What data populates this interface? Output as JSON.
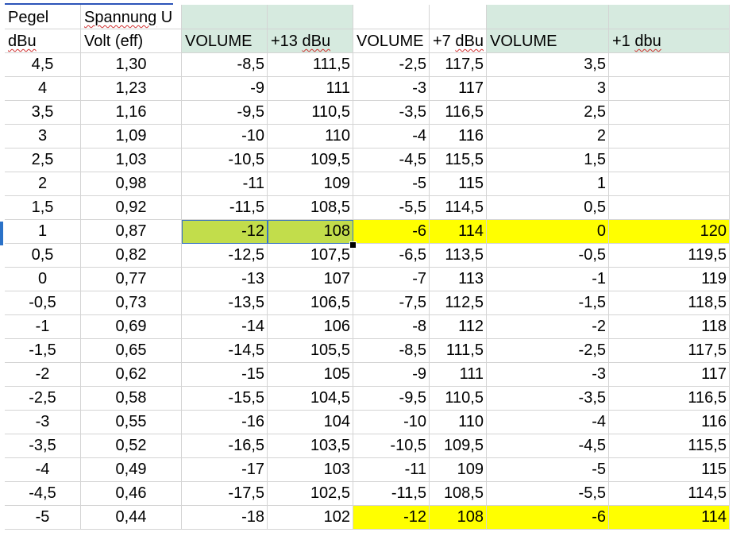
{
  "header_row1": [
    "Pegel",
    "Spannung U"
  ],
  "header_row2": [
    "dBu",
    "Volt (eff)",
    "VOLUME",
    "+13 dBu",
    "VOLUME",
    "+7 dBu",
    "VOLUME",
    "+1 dbu"
  ],
  "rows": [
    [
      "4,5",
      "1,30",
      "-8,5",
      "111,5",
      "-2,5",
      "117,5",
      "3,5",
      ""
    ],
    [
      "4",
      "1,23",
      "-9",
      "111",
      "-3",
      "117",
      "3",
      ""
    ],
    [
      "3,5",
      "1,16",
      "-9,5",
      "110,5",
      "-3,5",
      "116,5",
      "2,5",
      ""
    ],
    [
      "3",
      "1,09",
      "-10",
      "110",
      "-4",
      "116",
      "2",
      ""
    ],
    [
      "2,5",
      "1,03",
      "-10,5",
      "109,5",
      "-4,5",
      "115,5",
      "1,5",
      ""
    ],
    [
      "2",
      "0,98",
      "-11",
      "109",
      "-5",
      "115",
      "1",
      ""
    ],
    [
      "1,5",
      "0,92",
      "-11,5",
      "108,5",
      "-5,5",
      "114,5",
      "0,5",
      ""
    ],
    [
      "1",
      "0,87",
      "-12",
      "108",
      "-6",
      "114",
      "0",
      "120"
    ],
    [
      "0,5",
      "0,82",
      "-12,5",
      "107,5",
      "-6,5",
      "113,5",
      "-0,5",
      "119,5"
    ],
    [
      "0",
      "0,77",
      "-13",
      "107",
      "-7",
      "113",
      "-1",
      "119"
    ],
    [
      "-0,5",
      "0,73",
      "-13,5",
      "106,5",
      "-7,5",
      "112,5",
      "-1,5",
      "118,5"
    ],
    [
      "-1",
      "0,69",
      "-14",
      "106",
      "-8",
      "112",
      "-2",
      "118"
    ],
    [
      "-1,5",
      "0,65",
      "-14,5",
      "105,5",
      "-8,5",
      "111,5",
      "-2,5",
      "117,5"
    ],
    [
      "-2",
      "0,62",
      "-15",
      "105",
      "-9",
      "111",
      "-3",
      "117"
    ],
    [
      "-2,5",
      "0,58",
      "-15,5",
      "104,5",
      "-9,5",
      "110,5",
      "-3,5",
      "116,5"
    ],
    [
      "-3",
      "0,55",
      "-16",
      "104",
      "-10",
      "110",
      "-4",
      "116"
    ],
    [
      "-3,5",
      "0,52",
      "-16,5",
      "103,5",
      "-10,5",
      "109,5",
      "-4,5",
      "115,5"
    ],
    [
      "-4",
      "0,49",
      "-17",
      "103",
      "-11",
      "109",
      "-5",
      "115"
    ],
    [
      "-4,5",
      "0,46",
      "-17,5",
      "102,5",
      "-11,5",
      "108,5",
      "-5,5",
      "114,5"
    ],
    [
      "-5",
      "0,44",
      "-18",
      "102",
      "-12",
      "108",
      "-6",
      "114"
    ]
  ],
  "colors": {
    "header_green": "#d6eadf",
    "highlight_lime": "#c2dd4b",
    "highlight_yellow": "#ffff00",
    "grid": "#d4d4d4",
    "link_blue": "#2b53b8"
  }
}
